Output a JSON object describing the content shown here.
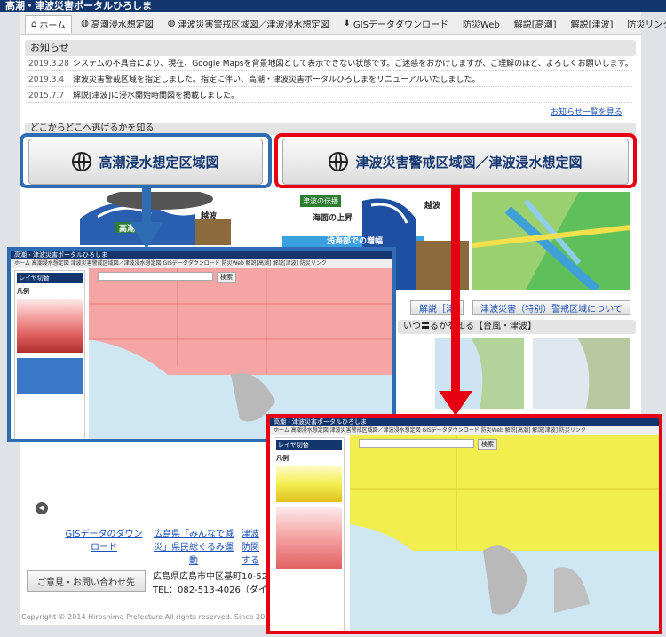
{
  "site": {
    "title": "高潮・津波災害ポータルひろしま"
  },
  "nav": [
    {
      "label": "ホーム",
      "icon": "home-icon"
    },
    {
      "label": "高潮浸水想定図",
      "icon": "globe-icon"
    },
    {
      "label": "津波災害警戒区域図／津波浸水想定図",
      "icon": "globe-icon"
    },
    {
      "label": "GISデータダウンロード",
      "icon": "download-icon"
    },
    {
      "label": "防災Web",
      "icon": ""
    },
    {
      "label": "解説[高潮]",
      "icon": ""
    },
    {
      "label": "解説[津波]",
      "icon": ""
    },
    {
      "label": "防災リンク",
      "icon": ""
    }
  ],
  "news": {
    "heading": "お知らせ",
    "items": [
      {
        "date": "2019.3.28",
        "text": "システムの不具合により、現在、Google Mapsを背景地図として表示できない状態です。ご迷惑をおかけしますが、ご理解のほど、よろしくお願いします。"
      },
      {
        "date": "2019.3.4",
        "text": "津波災害警戒区域を指定しました。指定に伴い、高潮・津波災害ポータルひろしまをリニューアルいたしました。"
      },
      {
        "date": "2015.7.7",
        "text": "解説[津波]に浸水開始時間図を掲載しました。"
      }
    ],
    "more_link": "お知らせ一覧を見る"
  },
  "section_where": "どこからどこへ逃げるかを知る",
  "buttons": {
    "storm_surge": "高潮浸水想定区域図",
    "tsunami": "津波災害警戒区域図／津波浸水想定図"
  },
  "illus": {
    "storm_label": "高潮",
    "tsunami_label1": "津波の伝播",
    "tsunami_label2": "海面の上昇",
    "tsunami_label3": "浅海部での増幅",
    "tsunami_label4": "越波",
    "storm_overtop": "越波"
  },
  "sub_buttons": {
    "explain_tsunami": "解説［津",
    "tsunami_zone": "津波災害（特別）警戒区域について"
  },
  "section_when": "いつ〓るかを知る【台風・津波】",
  "bottom_links": {
    "gis": "GISデータのダウンロード",
    "campaign": "広島県「みんなで減災」県民総ぐるみ運動",
    "tsunami_short": "津波防関する"
  },
  "contact": {
    "button": "ご意見・お問い合わせ先",
    "address": "広島県広島市中区基町10-52",
    "tel": "TEL：082-513-4026（ダイヤルイ"
  },
  "copyright": "Copyright © 2014 Hiroshima Prefecture All rights reserved. Since 20",
  "mapwin_blue": {
    "title": "高潮・津波災害ポータルひろしま",
    "nav": "ホーム  高潮浸水想定図  津波災害警戒区域図／津波浸水想定図  GISデータダウンロード  防災Web  解説[高潮]  解説[津波]  防災リンク",
    "layer_panel": "レイヤ切替",
    "legend": "凡例",
    "search": "検索"
  },
  "mapwin_red": {
    "title": "高潮・津波災害ポータルひろしま",
    "nav": "ホーム  高潮浸水想定図  津波災害警戒区域図／津波浸水想定図  GISデータダウンロード  防災Web  解説[高潮]  解説[津波]  防災リンク",
    "layer_panel": "レイヤ切替",
    "legend": "凡例",
    "search": "検索"
  },
  "colors": {
    "highlight_blue": "#2e6db4",
    "highlight_red": "#e60012",
    "storm_map": "#f6a5a5",
    "tsunami_map": "#f2ee4e"
  }
}
